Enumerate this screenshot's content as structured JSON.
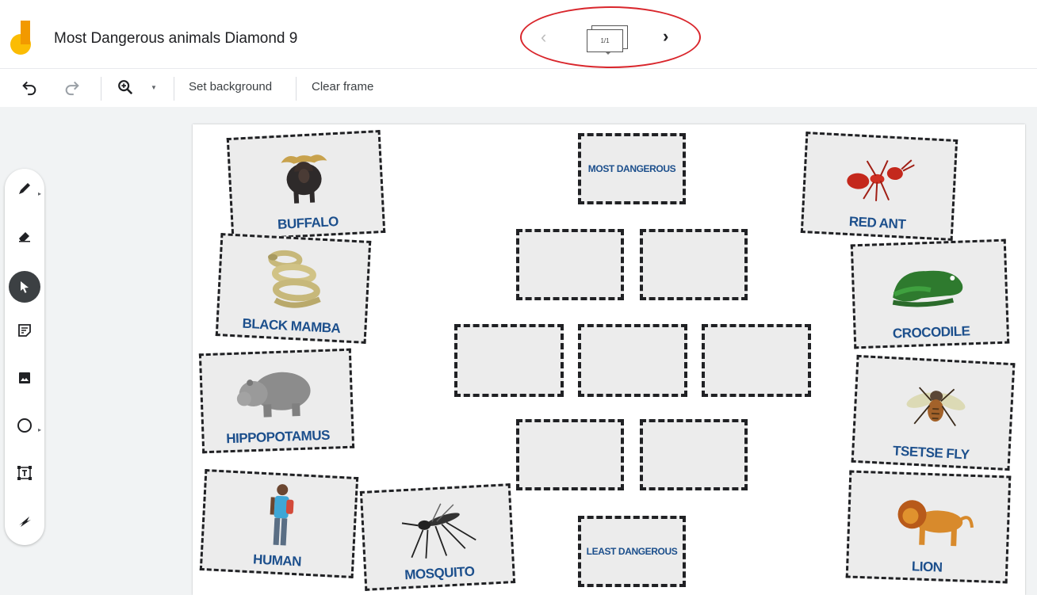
{
  "app": {
    "title": "Most Dangerous animals Diamond 9",
    "frame_counter": "1/1"
  },
  "toolbar": {
    "set_background_label": "Set background",
    "clear_frame_label": "Clear frame"
  },
  "icons": {
    "undo": "undo-icon",
    "redo": "redo-icon",
    "zoom": "zoom-icon",
    "pen": "pen-icon",
    "eraser": "eraser-icon",
    "select": "select-pointer-icon",
    "sticky_note": "sticky-note-icon",
    "image": "image-icon",
    "circle": "circle-shape-icon",
    "text_box": "text-box-icon",
    "laser": "laser-icon"
  },
  "colors": {
    "highlight_circle": "#d9262c",
    "label_blue": "#1c4f8c",
    "logo_yellow": "#fbbc04",
    "logo_orange": "#f29900"
  },
  "cards": [
    {
      "label": "BUFFALO"
    },
    {
      "label": "BLACK MAMBA"
    },
    {
      "label": "HIPPOPOTAMUS"
    },
    {
      "label": "HUMAN"
    },
    {
      "label": "MOSQUITO"
    },
    {
      "label": "RED ANT"
    },
    {
      "label": "CROCODILE"
    },
    {
      "label": "TSETSE FLY"
    },
    {
      "label": "LION"
    }
  ],
  "diamond": {
    "top_label": "MOST DANGEROUS",
    "bottom_label": "LEAST DANGEROUS"
  }
}
